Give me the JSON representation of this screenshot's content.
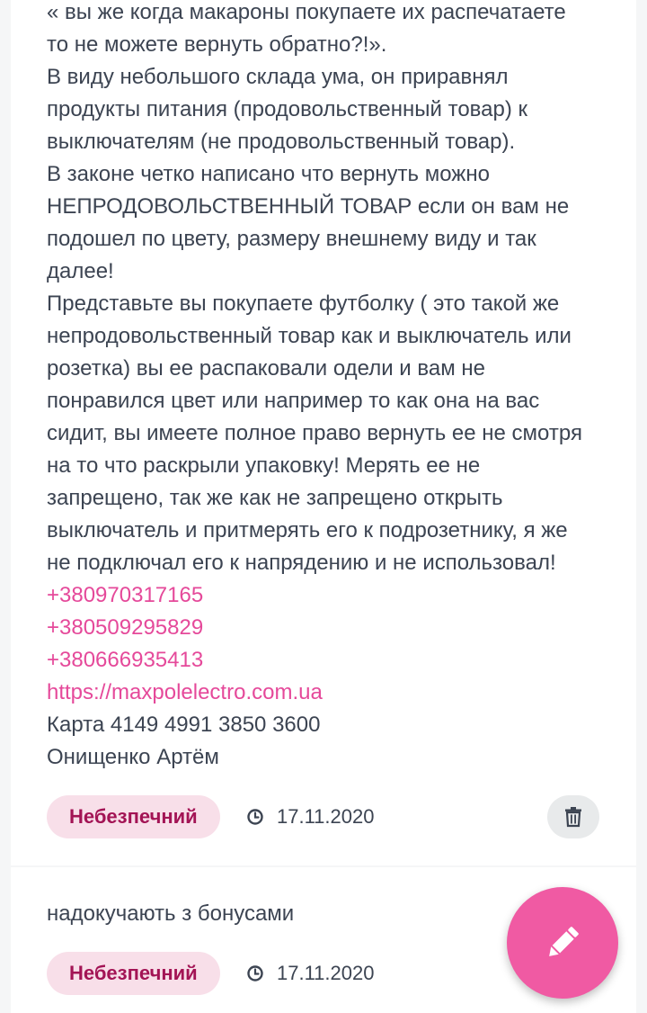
{
  "reviews": [
    {
      "lines": [
        "« вы же когда макароны покупаете их распечатаете",
        "то не можете вернуть обратно?!».",
        "В виду небольшого склада ума, он приравнял",
        "продукты питания (продовольственный товар) к",
        "выключателям (не продовольственный товар).",
        "В законе четко написано что вернуть можно",
        "НЕПРОДОВОЛЬСТВЕННЫЙ ТОВАР если он вам не",
        "подошел по цвету, размеру внешнему виду и так",
        "далее!",
        "Представьте вы покупаете футболку ( это такой же",
        "непродовольственный товар как и выключатель или",
        "розетка) вы ее распаковали одели и вам не",
        "понравился цвет или например то как она на вас",
        "сидит, вы имеете полное право вернуть ее не смотря",
        "на то что раскрыли упаковку! Мерять ее не",
        "запрещено, так же как не запрещено открыть",
        "выключатель и притмерять его к подрозетнику, я же",
        "не подключал его к напрядению и не использовал!"
      ],
      "phones": [
        "+380970317165",
        "+380509295829",
        "+380666935413"
      ],
      "website": "https://maxpolelectro.com.ua",
      "card_text": "Карта 4149 4991 3850 3600",
      "author_name": "Онищенко Артём",
      "badge": "Небезпечний",
      "date": "17.11.2020"
    },
    {
      "text": "надокучають з бонусами",
      "badge": "Небезпечний",
      "date": "17.11.2020"
    }
  ],
  "icons": {
    "clock": "clock-icon",
    "delete": "trash-icon",
    "fab": "pencil-icon"
  },
  "colors": {
    "text": "#3c4452",
    "link": "#e5499a",
    "badge_bg": "#f8dfe9",
    "badge_text": "#a31455",
    "fab": "#f05aa3",
    "page_bg": "#f5f6f7"
  }
}
